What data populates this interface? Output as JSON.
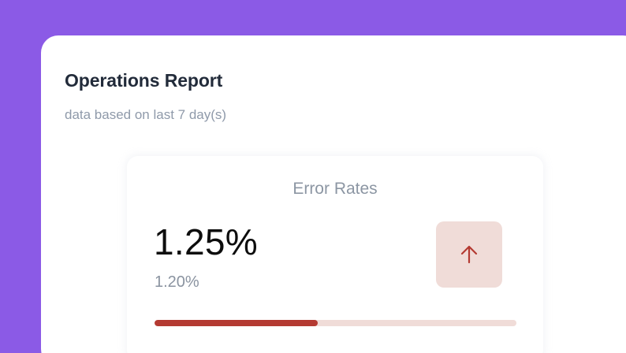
{
  "report": {
    "title": "Operations Report",
    "subtitle": "data based on last 7 day(s)"
  },
  "metric_card": {
    "title": "Error Rates",
    "value": "1.25%",
    "previous_value": "1.20%",
    "trend_icon": "arrow-up-icon",
    "trend_direction": "up",
    "progress_fraction": 0.45
  },
  "colors": {
    "background_accent": "#8b5ae6",
    "trend_box_background": "#f0dcd8",
    "trend_arrow": "#b43a32",
    "progress_fill": "#b43a32",
    "progress_track": "#f0dcd8"
  }
}
